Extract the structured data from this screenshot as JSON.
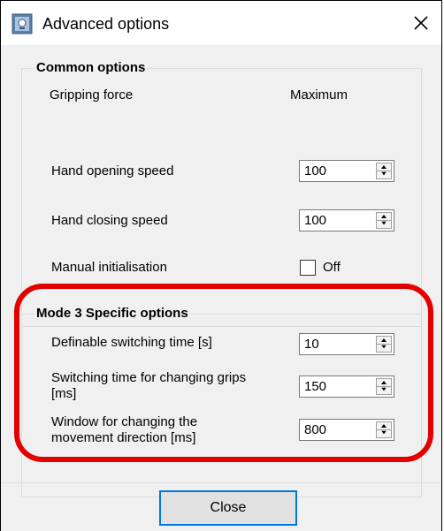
{
  "window": {
    "title": "Advanced options"
  },
  "common": {
    "title": "Common options",
    "gripping_force": {
      "label": "Gripping force",
      "value": "Maximum"
    },
    "opening_speed": {
      "label": "Hand opening speed",
      "value": "100"
    },
    "closing_speed": {
      "label": "Hand closing speed",
      "value": "100"
    },
    "manual_init": {
      "label": "Manual initialisation",
      "value": "Off",
      "checked": false
    }
  },
  "mode3": {
    "title": "Mode 3 Specific options",
    "switching_time": {
      "label": "Definable switching time [s]",
      "value": "10"
    },
    "grip_switch_time": {
      "label_line1": "Switching time for changing grips",
      "label_line2": "[ms]",
      "value": "150"
    },
    "direction_window": {
      "label_line1": "Window for changing the",
      "label_line2": "movement direction [ms]",
      "value": "800"
    }
  },
  "footer": {
    "close_label": "Close"
  },
  "colors": {
    "annotation": "#e30000",
    "focus_border": "#0078d7"
  }
}
